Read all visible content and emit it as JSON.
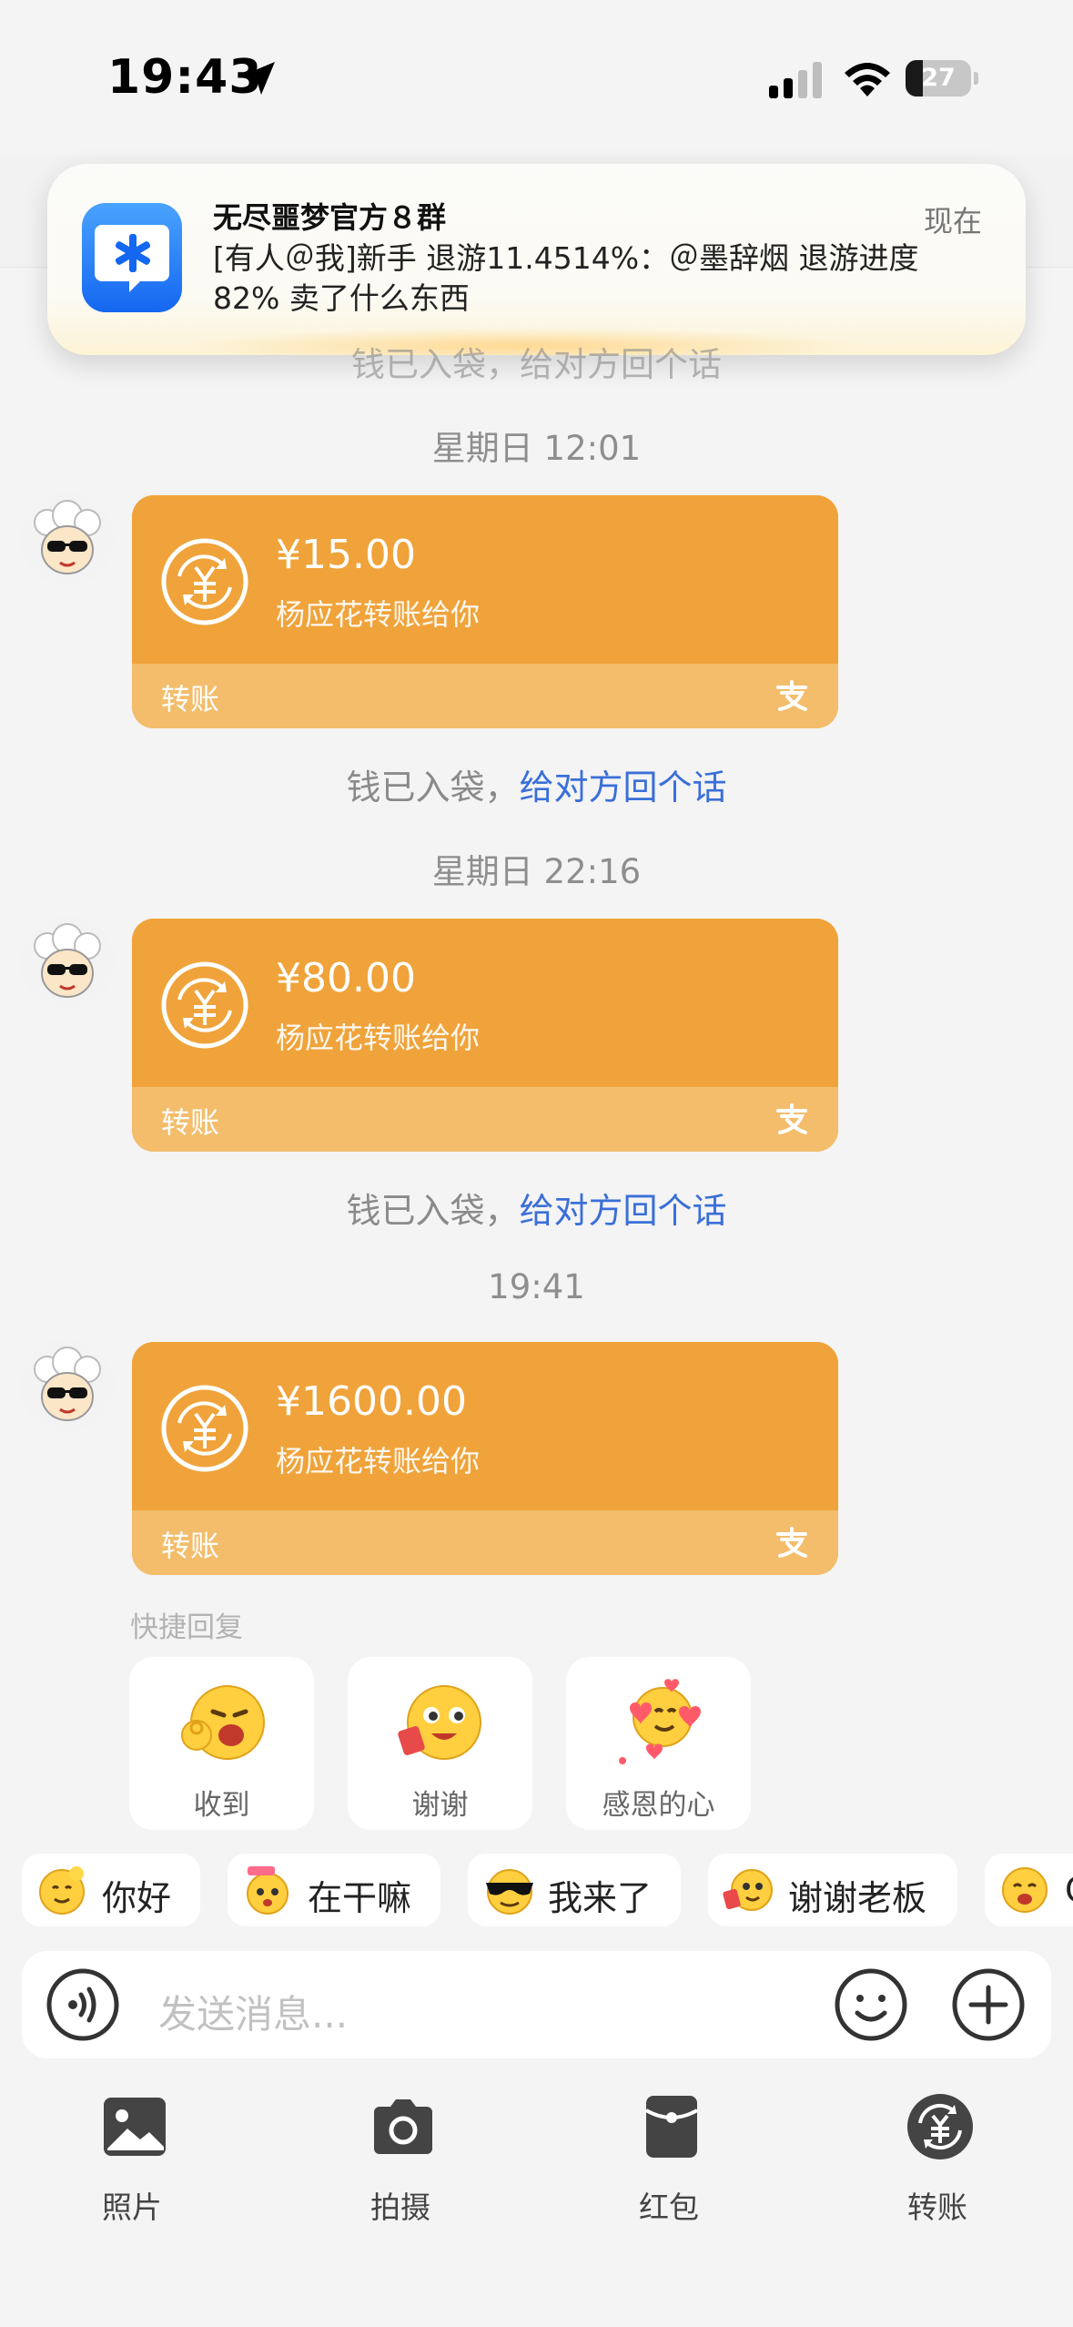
{
  "status_bar": {
    "time": "19:43",
    "battery_level": "27",
    "battery_fraction": 0.27
  },
  "notification": {
    "app_icon": "qq-app-icon",
    "title": "无尽噩梦官方８群",
    "time": "现在",
    "body": "[有人＠我]新手 退游11.4514%：＠墨辞烟 退游进度 82% 卖了什么东西"
  },
  "chat": {
    "partial_note": "钱已入袋，给对方回个话",
    "messages": [
      {
        "timestamp": "星期日 12:01",
        "amount": "¥15.00",
        "subtitle": "杨应花转账给你",
        "type_label": "转账",
        "received_prefix": "钱已入袋，",
        "received_link": "给对方回个话"
      },
      {
        "timestamp": "星期日 22:16",
        "amount": "¥80.00",
        "subtitle": "杨应花转账给你",
        "type_label": "转账",
        "received_prefix": "钱已入袋，",
        "received_link": "给对方回个话"
      },
      {
        "timestamp": "19:41",
        "amount": "¥1600.00",
        "subtitle": "杨应花转账给你",
        "type_label": "转账"
      }
    ]
  },
  "quick_reply": {
    "label": "快捷回复",
    "items": [
      {
        "label": "收到",
        "icon": "ok-hand-emoji-icon"
      },
      {
        "label": "谢谢",
        "icon": "thanks-emoji-icon"
      },
      {
        "label": "感恩的心",
        "icon": "hearts-emoji-icon"
      }
    ]
  },
  "chips": [
    {
      "label": "你好",
      "icon": "wave-emoji-icon"
    },
    {
      "label": "在干嘛",
      "icon": "busy-emoji-icon"
    },
    {
      "label": "我来了",
      "icon": "sunglasses-emoji-icon"
    },
    {
      "label": "谢谢老板",
      "icon": "boss-thanks-emoji-icon"
    },
    {
      "label": "C",
      "icon": "laugh-emoji-icon"
    }
  ],
  "input": {
    "placeholder": "发送消息..."
  },
  "toolbar": [
    {
      "label": "照片",
      "icon": "photo-icon"
    },
    {
      "label": "拍摄",
      "icon": "camera-icon"
    },
    {
      "label": "红包",
      "icon": "red-packet-icon"
    },
    {
      "label": "转账",
      "icon": "transfer-icon"
    }
  ],
  "colors": {
    "card_primary": "#f0a33a",
    "card_footer": "#f3bd6c",
    "link": "#3a6fd8",
    "background": "#f4f4f4"
  }
}
